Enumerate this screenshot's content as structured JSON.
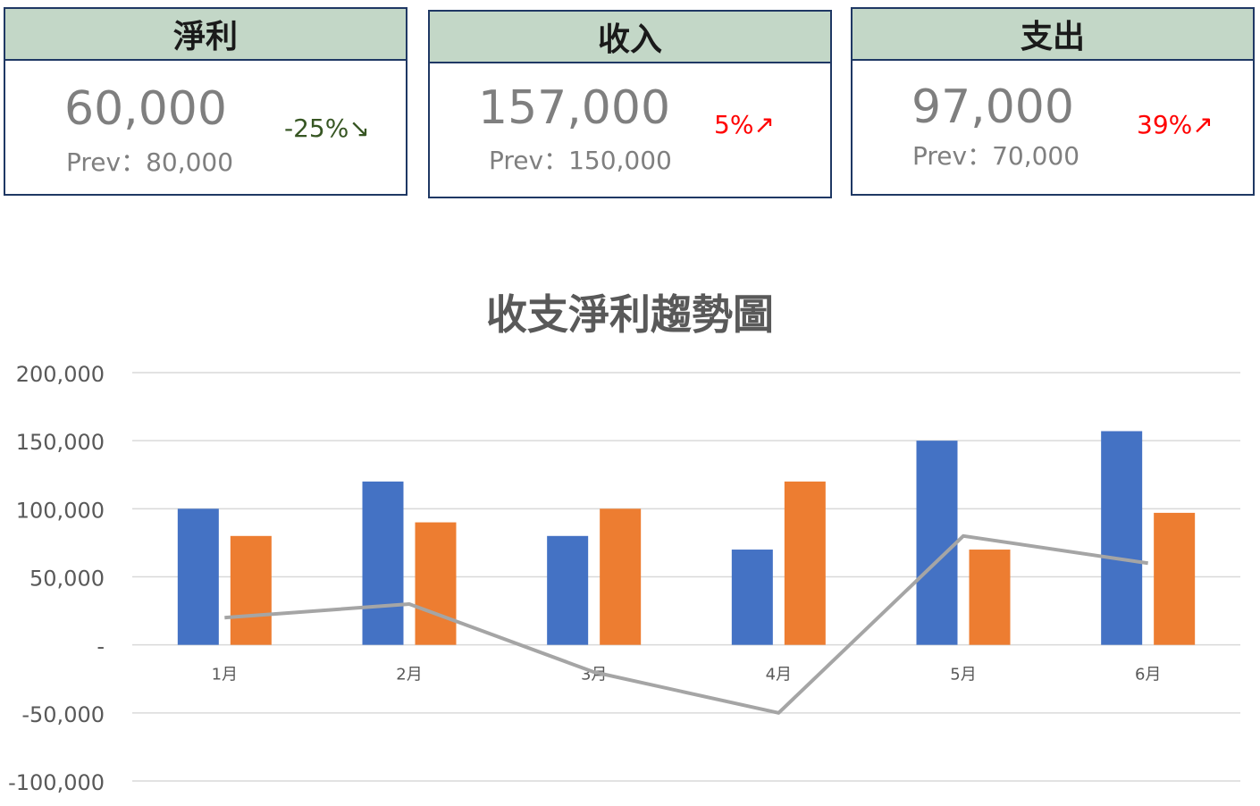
{
  "kpis": {
    "net_profit": {
      "title": "淨利",
      "value": "60,000",
      "prev": "Prev：80,000",
      "change": "-25%↘",
      "trend": "down",
      "change_color": "#375623"
    },
    "revenue": {
      "title": "收入",
      "value": "157,000",
      "prev": "Prev：150,000",
      "change": "5%↗",
      "trend": "up",
      "change_color": "#ff0000"
    },
    "expense": {
      "title": "支出",
      "value": "97,000",
      "prev": "Prev：70,000",
      "change": "39%↗",
      "trend": "up",
      "change_color": "#ff0000"
    }
  },
  "colors": {
    "card_header_bg": "#c3d7c7",
    "card_border": "#1f3864",
    "revenue_bar": "#4472c4",
    "expense_bar": "#ed7d31",
    "net_line": "#a5a5a5"
  },
  "chart_data": {
    "type": "bar",
    "title": "收支淨利趨勢圖",
    "categories": [
      "1月",
      "2月",
      "3月",
      "4月",
      "5月",
      "6月"
    ],
    "series": [
      {
        "values": [
          100000,
          120000,
          80000,
          70000,
          150000,
          157000
        ],
        "kind": "bar",
        "color": "#4472c4"
      },
      {
        "values": [
          80000,
          90000,
          100000,
          120000,
          70000,
          97000
        ],
        "kind": "bar",
        "color": "#ed7d31"
      },
      {
        "values": [
          20000,
          30000,
          -20000,
          -50000,
          80000,
          60000
        ],
        "kind": "line",
        "color": "#a5a5a5"
      }
    ],
    "ylim": [
      -100000,
      200000
    ],
    "yticks": [
      200000,
      150000,
      100000,
      50000,
      0,
      -50000,
      -100000
    ],
    "ytick_labels": [
      "200,000",
      "150,000",
      "100,000",
      "50,000",
      "-",
      "-50,000",
      "-100,000"
    ],
    "grid": true,
    "legend": "none"
  }
}
